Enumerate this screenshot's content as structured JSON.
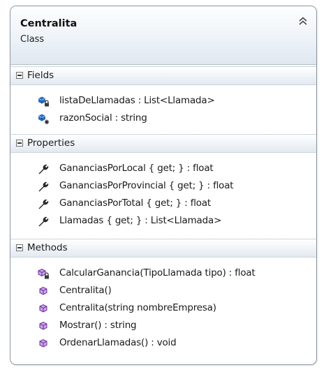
{
  "class": {
    "name": "Centralita",
    "stereotype": "Class"
  },
  "sections": {
    "fields": {
      "label": "Fields",
      "items": [
        {
          "text": "listaDeLlamadas : List<Llamada>",
          "icon": "private-field-icon"
        },
        {
          "text": "razonSocial : string",
          "icon": "protected-field-icon"
        }
      ]
    },
    "properties": {
      "label": "Properties",
      "items": [
        {
          "text": "GananciasPorLocal { get; } : float",
          "icon": "property-wrench-icon"
        },
        {
          "text": "GananciasPorProvincial { get; } : float",
          "icon": "property-wrench-icon"
        },
        {
          "text": "GananciasPorTotal { get; } : float",
          "icon": "property-wrench-icon"
        },
        {
          "text": "Llamadas { get; } : List<Llamada>",
          "icon": "property-wrench-icon"
        }
      ]
    },
    "methods": {
      "label": "Methods",
      "items": [
        {
          "text": "CalcularGanancia(TipoLlamada tipo) : float",
          "icon": "private-method-icon"
        },
        {
          "text": "Centralita()",
          "icon": "public-method-icon"
        },
        {
          "text": "Centralita(string nombreEmpresa)",
          "icon": "public-method-icon"
        },
        {
          "text": "Mostrar() : string",
          "icon": "public-method-icon"
        },
        {
          "text": "OrdenarLlamadas() : void",
          "icon": "public-method-icon"
        }
      ]
    }
  },
  "colors": {
    "field": "#1d5fa8",
    "method": "#7a3fa8",
    "wrench": "#2b2b2b",
    "header": "#e6edf5"
  }
}
